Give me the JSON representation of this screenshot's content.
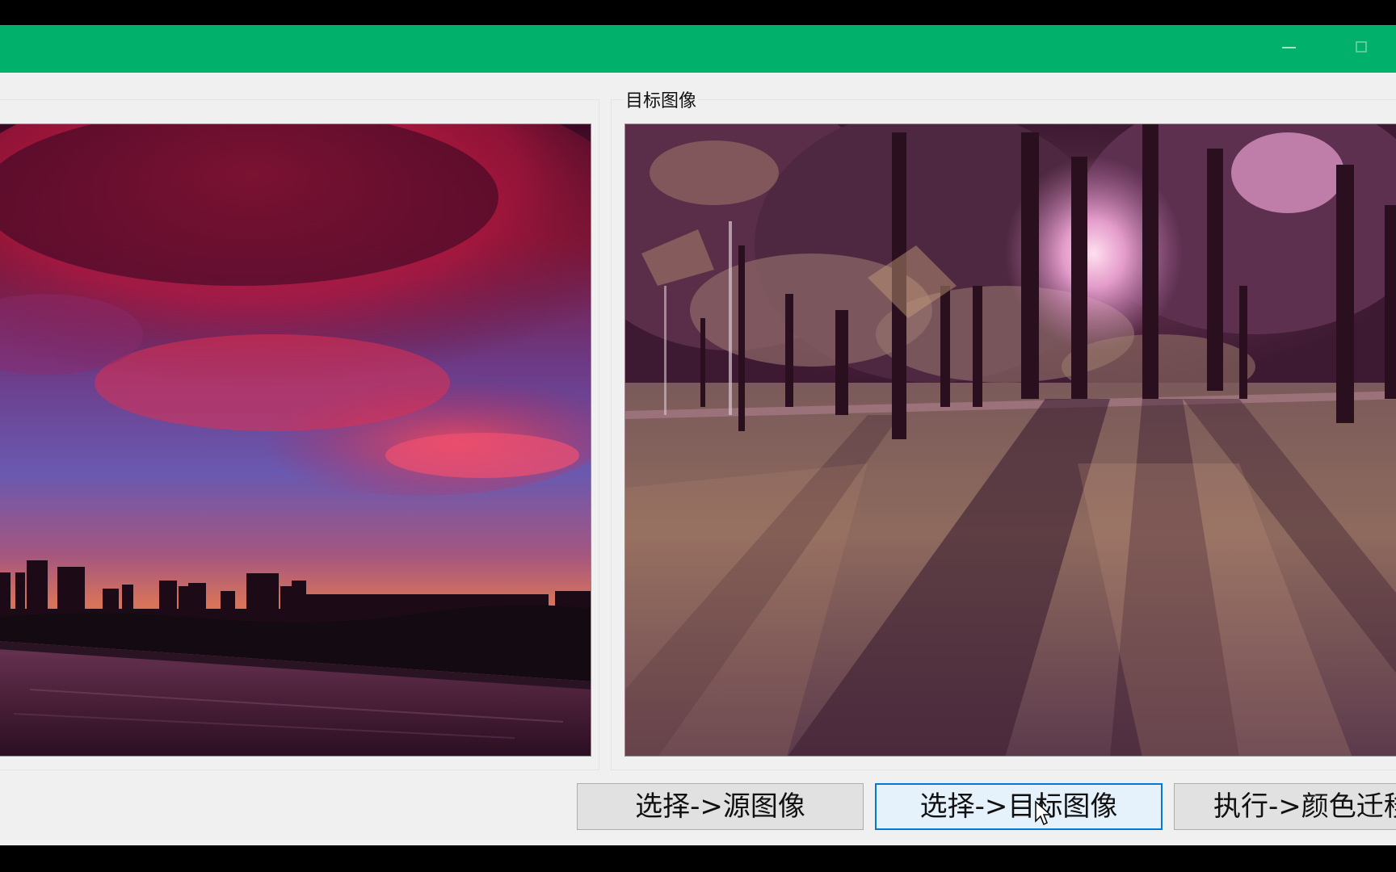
{
  "app": {
    "title": "",
    "titlebar_color": "#00b06b",
    "titlebar_buttons": [
      "minimize-icon",
      "maximize-icon"
    ]
  },
  "source_panel": {
    "label": "",
    "image": "sunset-city-skyline-over-water"
  },
  "target_panel": {
    "label": "目标图像",
    "image": "park-trees-sunlight-long-shadows"
  },
  "buttons": {
    "select_source": "选择->源图像",
    "select_target": "选择->目标图像",
    "execute": "执行->颜色迁移"
  },
  "state": {
    "hovered_button": "select_target"
  }
}
